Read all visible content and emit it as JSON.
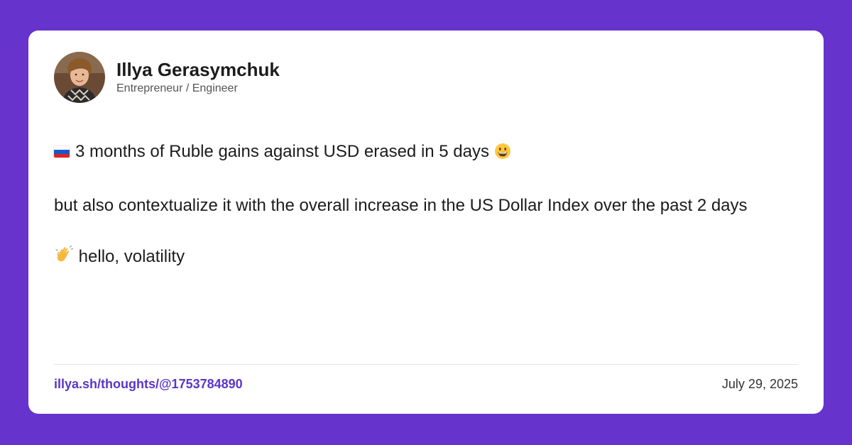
{
  "author": {
    "name": "Illya Gerasymchuk",
    "role": "Entrepreneur / Engineer"
  },
  "post": {
    "line1": "3 months of Ruble gains against USD erased in 5 days",
    "line2": "but also contextualize it with the overall increase in the US Dollar Index over the past 2 days",
    "line3": "hello, volatility"
  },
  "footer": {
    "link": "illya.sh/thoughts/@1753784890",
    "date": "July 29, 2025"
  },
  "colors": {
    "background": "#6633CC",
    "card": "#FFFFFF",
    "link": "#5B35C8"
  },
  "icons": {
    "flag": "russia-flag-icon",
    "grin": "grinning-face-icon",
    "wave": "waving-hand-icon"
  }
}
